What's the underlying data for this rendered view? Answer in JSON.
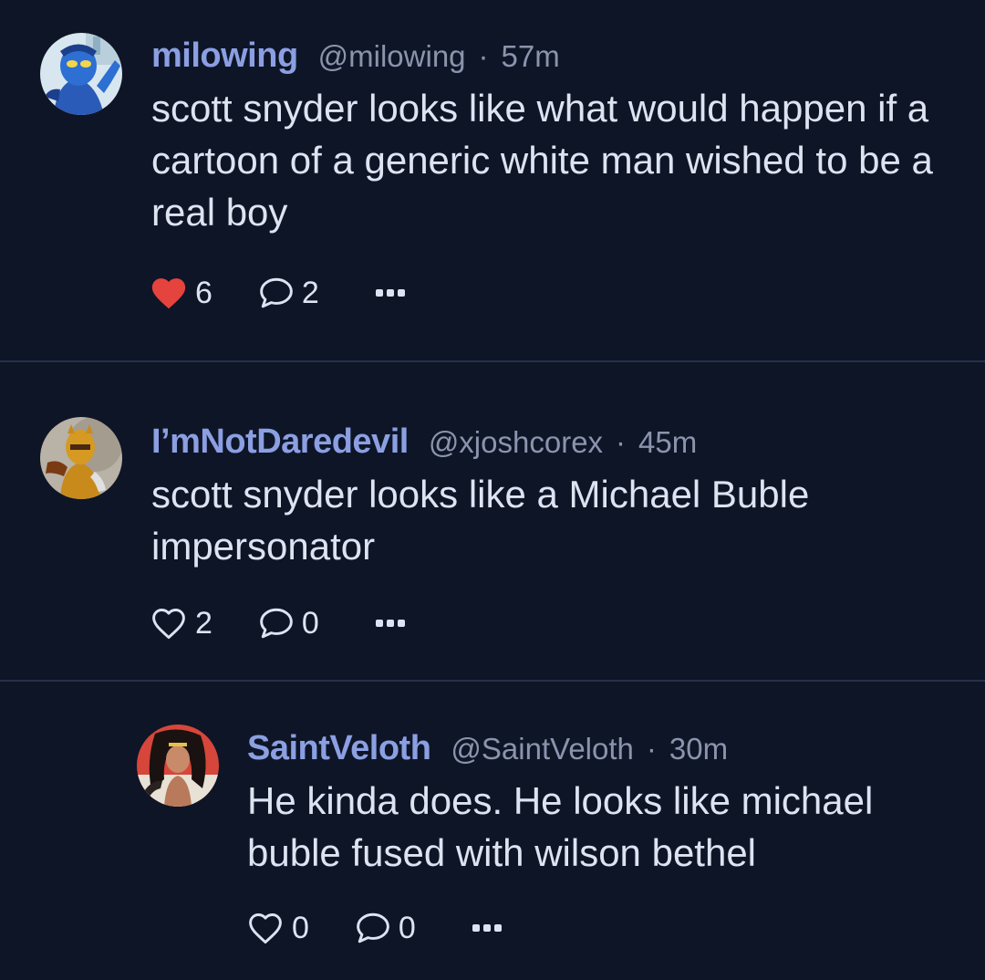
{
  "posts": [
    {
      "display_name": "milowing",
      "handle": "@milowing",
      "separator": "·",
      "time": "57m",
      "text": "scott snyder looks like what would happen if a cartoon of a generic white man wished to be a real boy",
      "likes": "6",
      "liked": true,
      "replies": "2",
      "avatar_icon": "blue-beetle-avatar"
    },
    {
      "display_name": "I’mNotDaredevil",
      "handle": "@xjoshcorex",
      "separator": "·",
      "time": "45m",
      "text": "scott snyder looks like a Michael Buble impersonator",
      "likes": "2",
      "liked": false,
      "replies": "0",
      "avatar_icon": "daredevil-avatar"
    },
    {
      "display_name": "SaintVeloth",
      "handle": "@SaintVeloth",
      "separator": "·",
      "time": "30m",
      "text": "He kinda does. He looks like michael buble fused with wilson bethel",
      "likes": "0",
      "liked": false,
      "replies": "0",
      "avatar_icon": "wonder-woman-avatar"
    }
  ],
  "colors": {
    "background": "#0e1527",
    "display_name": "#8b9fe2",
    "meta": "#8b94ad",
    "text": "#dde3f1",
    "divider": "#253149",
    "like_active": "#e5433d"
  }
}
